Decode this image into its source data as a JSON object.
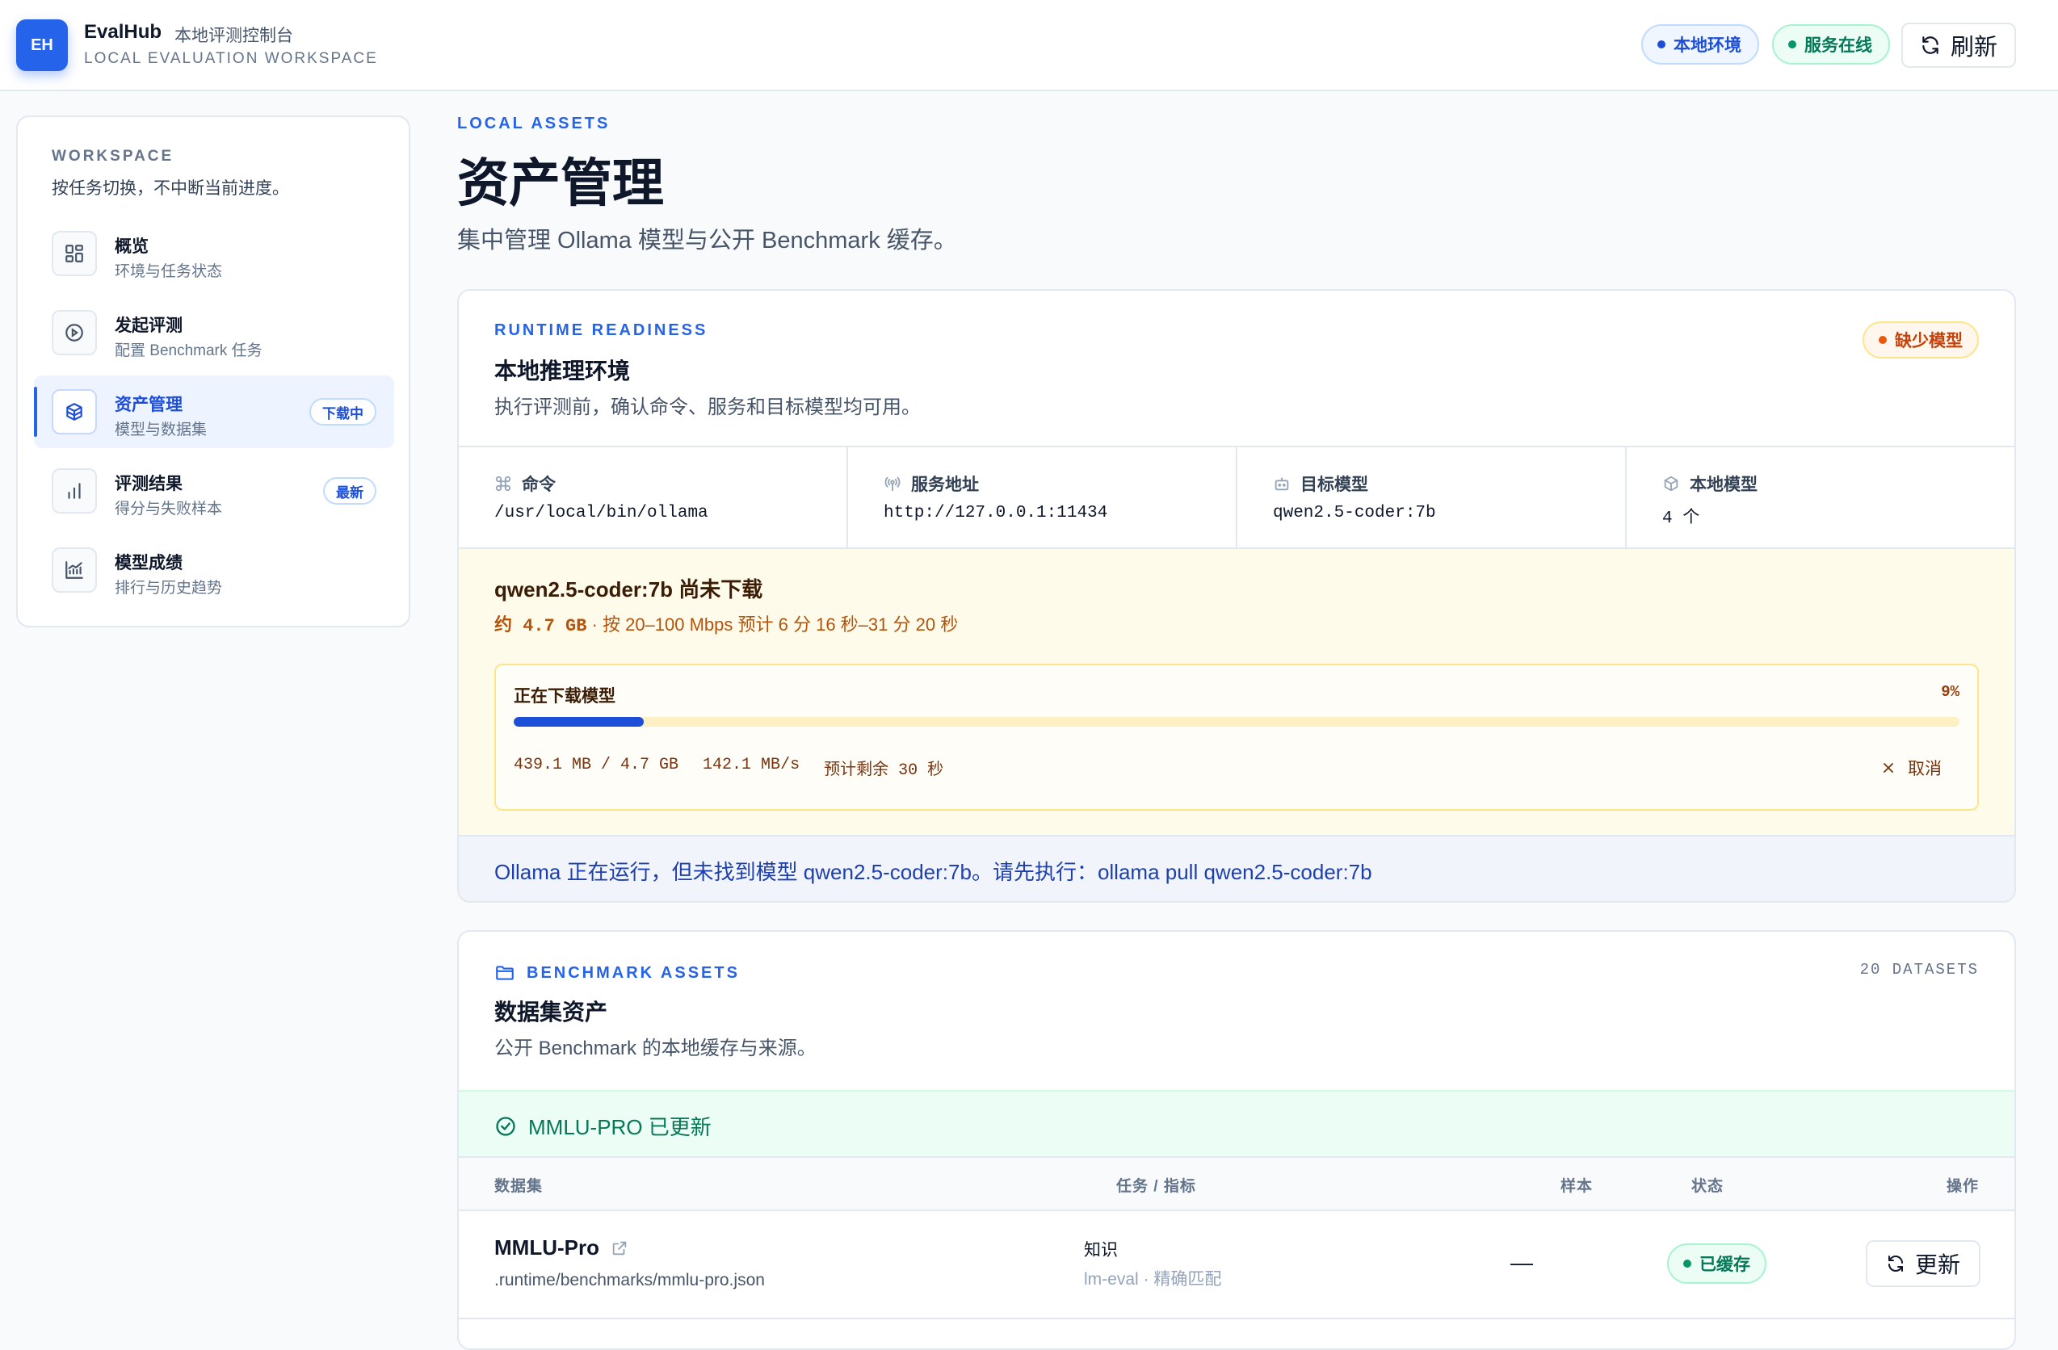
{
  "header": {
    "logo": "EH",
    "app_name": "EvalHub",
    "app_subtitle": "本地评测控制台",
    "app_tagline": "LOCAL EVALUATION WORKSPACE",
    "env_pill": "本地环境",
    "status_pill": "服务在线",
    "refresh_label": "刷新"
  },
  "sidebar": {
    "label": "WORKSPACE",
    "description": "按任务切换，不中断当前进度。",
    "items": [
      {
        "title": "概览",
        "subtitle": "环境与任务状态",
        "icon": "grid-icon"
      },
      {
        "title": "发起评测",
        "subtitle": "配置 Benchmark 任务",
        "icon": "play-circle-icon"
      },
      {
        "title": "资产管理",
        "subtitle": "模型与数据集",
        "icon": "box-icon",
        "badge": "下载中",
        "active": true
      },
      {
        "title": "评测结果",
        "subtitle": "得分与失败样本",
        "icon": "bar-chart-icon",
        "badge": "最新"
      },
      {
        "title": "模型成绩",
        "subtitle": "排行与历史趋势",
        "icon": "trend-chart-icon"
      }
    ]
  },
  "page": {
    "eyebrow": "LOCAL ASSETS",
    "title": "资产管理",
    "description": "集中管理 Ollama 模型与公开 Benchmark 缓存。"
  },
  "runtime": {
    "eyebrow": "RUNTIME READINESS",
    "title": "本地推理环境",
    "description": "执行评测前，确认命令、服务和目标模型均可用。",
    "status_pill": "缺少模型",
    "stats": [
      {
        "label": "命令",
        "value": "/usr/local/bin/ollama",
        "icon": "command-icon"
      },
      {
        "label": "服务地址",
        "value": "http://127.0.0.1:11434",
        "icon": "broadcast-icon"
      },
      {
        "label": "目标模型",
        "value": "qwen2.5-coder:7b",
        "icon": "bot-icon"
      },
      {
        "label": "本地模型",
        "value": "4 个",
        "icon": "cube-icon"
      }
    ],
    "download": {
      "title": "qwen2.5-coder:7b 尚未下载",
      "size": "约 4.7 GB",
      "estimate": " · 按 20–100 Mbps 预计 6 分 16 秒–31 分 20 秒",
      "progress_label": "正在下载模型",
      "progress_percent_text": "9%",
      "progress": 0.09,
      "transferred": "439.1 MB / 4.7 GB",
      "speed": "142.1 MB/s",
      "remaining": "预计剩余 30 秒",
      "cancel_label": "取消"
    },
    "info_message": "Ollama 正在运行，但未找到模型 qwen2.5-coder:7b。请先执行：ollama pull qwen2.5-coder:7b"
  },
  "datasets": {
    "eyebrow": "BENCHMARK ASSETS",
    "title": "数据集资产",
    "description": "公开 Benchmark 的本地缓存与来源。",
    "count_label": "20 DATASETS",
    "success_message": "MMLU-PRO 已更新",
    "columns": [
      "数据集",
      "任务 / 指标",
      "样本",
      "状态",
      "操作"
    ],
    "rows": [
      {
        "name": "MMLU-Pro",
        "path": ".runtime/benchmarks/mmlu-pro.json",
        "task": "知识",
        "metric": "lm-eval · 精确匹配",
        "samples": "—",
        "status": "已缓存",
        "action": "更新"
      }
    ]
  },
  "colors": {
    "accent": "#2563eb",
    "success": "#047857",
    "warning": "#c2410c",
    "info": "#1e40af"
  }
}
